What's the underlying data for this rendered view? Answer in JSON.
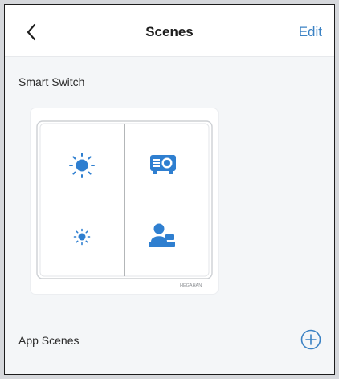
{
  "header": {
    "title": "Scenes",
    "edit_label": "Edit"
  },
  "smart_switch": {
    "label": "Smart Switch",
    "brand_mark": "HEGAHAN",
    "buttons": [
      {
        "icon": "sun-large-icon"
      },
      {
        "icon": "projector-icon"
      },
      {
        "icon": "sun-small-icon"
      },
      {
        "icon": "meeting-person-icon"
      }
    ]
  },
  "app_scenes": {
    "label": "App Scenes"
  },
  "colors": {
    "accent": "#3b82c4",
    "icon": "#2f7fd0"
  }
}
